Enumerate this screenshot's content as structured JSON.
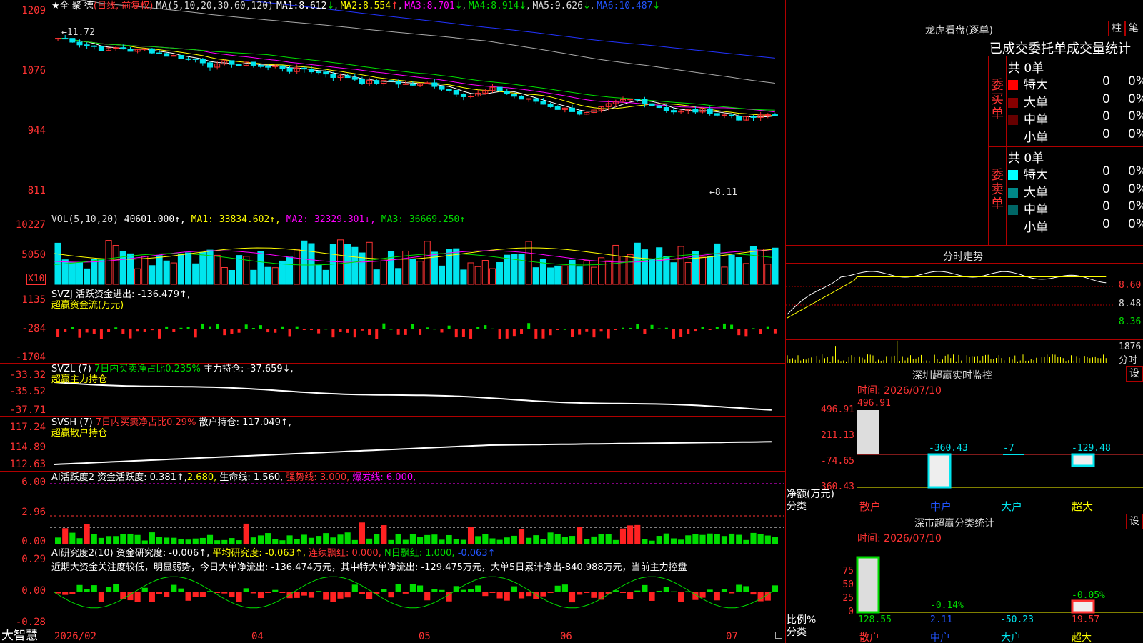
{
  "stock": {
    "star": "★",
    "name": "全 聚 德",
    "mode": "(日线, 前复权)"
  },
  "colors": {
    "up": "#ff3333",
    "down": "#00e5ee",
    "green": "#00dd00",
    "white": "#ffffff",
    "yellow": "#ffff00",
    "magenta": "#ff00ff",
    "blue": "#2233ff",
    "gray": "#aaaaaa",
    "grid": "#b00000"
  },
  "kline": {
    "params": "MA(5,10,20,30,60,120)",
    "ma": [
      {
        "label": "MA1:",
        "value": "8.612",
        "arrow": "↓"
      },
      {
        "label": "MA2:",
        "value": "8.554",
        "arrow": "↑"
      },
      {
        "label": "MA3:",
        "value": "8.701",
        "arrow": "↓"
      },
      {
        "label": "MA4:",
        "value": "8.914",
        "arrow": "↓"
      },
      {
        "label": "MA5:",
        "value": "9.626",
        "arrow": "↓"
      },
      {
        "label": "MA6:",
        "value": "10.487",
        "arrow": "↓"
      }
    ],
    "yticks": [
      "1209",
      "1076",
      "944",
      "811"
    ],
    "high_label": "11.72",
    "low_label": "8.11"
  },
  "vol": {
    "header": "VOL(5,10,20)",
    "value": "40601.000↑,",
    "ma1": "MA1: 33834.602↑,",
    "ma2": "MA2: 32329.301↓,",
    "ma3": "MA3: 36669.250↑",
    "yticks": [
      "10227",
      "5050"
    ],
    "unit": "X10"
  },
  "svzj": {
    "header": "SVZJ  活跃资金进出: -136.479↑,",
    "sub": "超赢资金流(万元)",
    "yticks": [
      "1135",
      "-284",
      "-1704"
    ]
  },
  "svzl": {
    "h1": "SVZL (7) ",
    "h2": "7日内买卖净占比0.235%",
    "h3": " 主力持仓: -37.659↓,",
    "sub": "超赢主力持仓",
    "yticks": [
      "-33.32",
      "-35.52",
      "-37.71"
    ]
  },
  "svsh": {
    "h1": "SVSH (7) ",
    "h2": "7日内买卖净占比0.29%",
    "h3": " 散户持仓: 117.049↑,",
    "sub": "超赢散户持仓",
    "yticks": [
      "117.24",
      "114.89",
      "112.63"
    ]
  },
  "ai1": {
    "h1": "AI活跃度2 资金活跃度: 0.381↑,",
    "h2": "2.680,",
    "h3": " 生命线: 1.560,",
    "h4": " 强势线: 3.000,",
    "h5": " 爆发线: 6.000,",
    "yticks": [
      "6.00",
      "2.96",
      "0.00"
    ]
  },
  "ai2": {
    "h1": "AI研究度2(10) 资金研究度: -0.006↑,",
    "h2": " 平均研究度: -0.063↑,",
    "h3": " 连续飘红: 0.000,",
    "h4": " N日飘红: 1.000,",
    "h5": " -0.063↑",
    "news": "近期大资金关注度较低，明显弱势，今日大单净流出: -136.474万元，其中特大单净流出: -129.475万元，大单5日累计净出-840.988万元，当前主力控盘",
    "yticks": [
      "0.29",
      "0.00",
      "-0.28"
    ]
  },
  "xaxis": [
    "2026/02",
    "04",
    "05",
    "06",
    "07"
  ],
  "brand": "大智慧",
  "lhb": {
    "title": "龙虎看盘(逐单)",
    "btn1": "柱",
    "btn2": "笔",
    "stat_title": "已成交委托单成交量统计",
    "buy_label": "委买单",
    "sell_label": "委卖单",
    "buy_total": "共 0单",
    "sell_total": "共 0单",
    "buy_rows": [
      {
        "name": "特大",
        "count": "0",
        "pct": "0%",
        "color": "#ff0000"
      },
      {
        "name": "大单",
        "count": "0",
        "pct": "0%",
        "color": "#880000"
      },
      {
        "name": "中单",
        "count": "0",
        "pct": "0%",
        "color": "#660000"
      },
      {
        "name": "小单",
        "count": "0",
        "pct": "0%",
        "color": "#000000"
      }
    ],
    "sell_rows": [
      {
        "name": "特大",
        "count": "0",
        "pct": "0%",
        "color": "#00ffff"
      },
      {
        "name": "大单",
        "count": "0",
        "pct": "0%",
        "color": "#008888"
      },
      {
        "name": "中单",
        "count": "0",
        "pct": "0%",
        "color": "#006666"
      },
      {
        "name": "小单",
        "count": "0",
        "pct": "0%",
        "color": "#000000"
      }
    ]
  },
  "intraday": {
    "title": "分时走势",
    "y": [
      "8.60",
      "8.48",
      "8.36"
    ],
    "vol": "1876",
    "vol_label": "分时"
  },
  "monitor": {
    "title": "深圳超赢实时监控",
    "btn": "设",
    "time": "时间: 2026/07/10",
    "y": [
      "496.91",
      "211.13",
      "-74.65",
      "-360.43"
    ],
    "ylabel1": "净额(万元)",
    "ylabel2": "分类",
    "cats": [
      "散户",
      "中户",
      "大户",
      "超大"
    ],
    "values": [
      "496.91",
      "-360.43",
      "-7",
      "-129.48"
    ]
  },
  "cls": {
    "title": "深市超赢分类统计",
    "btn": "设",
    "time": "时间: 2026/07/10",
    "y": [
      "75",
      "50",
      "25",
      "0"
    ],
    "ylabel1": "比例%",
    "ylabel2": "分类",
    "cats": [
      "散户",
      "中户",
      "大户",
      "超大"
    ],
    "pcts": [
      "",
      "-0.14%",
      "",
      "-0.05%"
    ],
    "values": [
      "128.55",
      "2.11",
      "-50.23",
      "19.57"
    ]
  }
}
